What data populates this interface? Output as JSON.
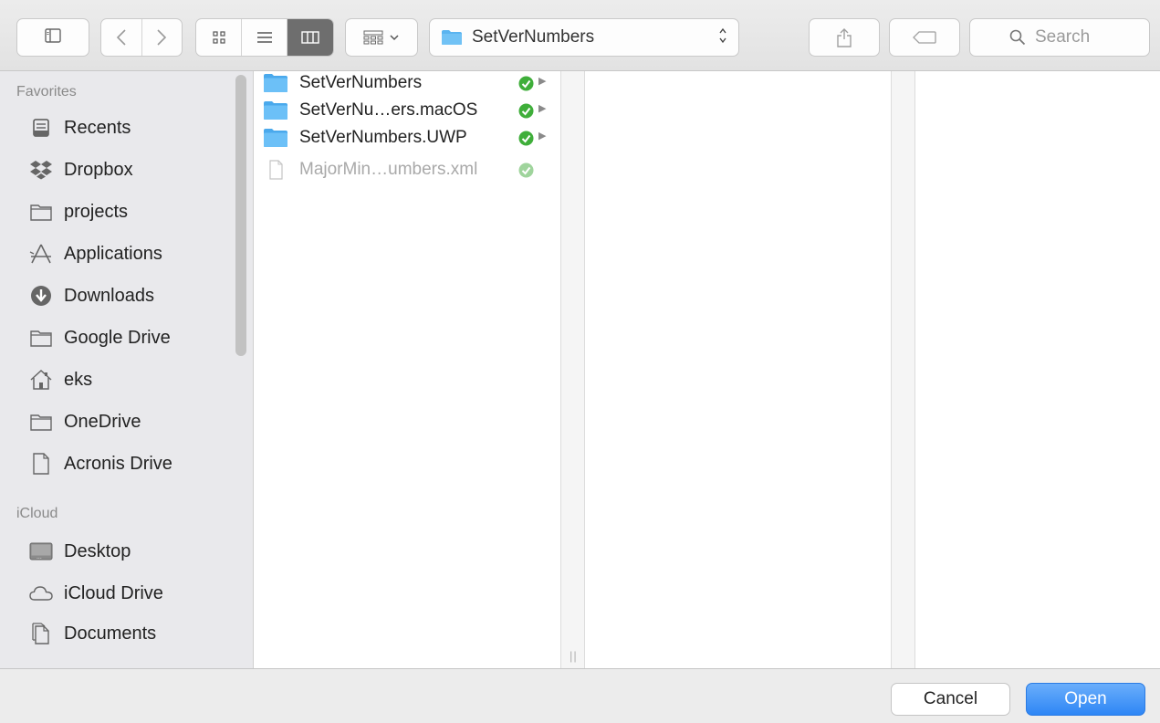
{
  "toolbar": {
    "path_folder": "SetVerNumbers",
    "search_placeholder": "Search"
  },
  "sidebar": {
    "favorites_heading": "Favorites",
    "favorites": [
      {
        "label": "Recents",
        "icon": "recents-icon"
      },
      {
        "label": "Dropbox",
        "icon": "dropbox-icon"
      },
      {
        "label": "projects",
        "icon": "folder-icon"
      },
      {
        "label": "Applications",
        "icon": "applications-icon"
      },
      {
        "label": "Downloads",
        "icon": "downloads-icon"
      },
      {
        "label": "Google Drive",
        "icon": "folder-icon"
      },
      {
        "label": "eks",
        "icon": "home-icon"
      },
      {
        "label": "OneDrive",
        "icon": "folder-icon"
      },
      {
        "label": "Acronis Drive",
        "icon": "document-icon"
      }
    ],
    "icloud_heading": "iCloud",
    "icloud": [
      {
        "label": "Desktop",
        "icon": "desktop-icon"
      },
      {
        "label": "iCloud Drive",
        "icon": "cloud-icon"
      },
      {
        "label": "Documents",
        "icon": "documents-icon"
      }
    ]
  },
  "files": [
    {
      "name": "SetVerNumbers",
      "type": "folder",
      "enabled": true
    },
    {
      "name": "SetVerNu…ers.macOS",
      "type": "folder",
      "enabled": true
    },
    {
      "name": "SetVerNumbers.UWP",
      "type": "folder",
      "enabled": true
    },
    {
      "name": "MajorMin…umbers.xml",
      "type": "file",
      "enabled": false
    }
  ],
  "buttons": {
    "cancel": "Cancel",
    "open": "Open"
  },
  "colors": {
    "accent": "#2e86f5",
    "folder": "#5ab4f0",
    "sync_check": "#3fae3a"
  }
}
